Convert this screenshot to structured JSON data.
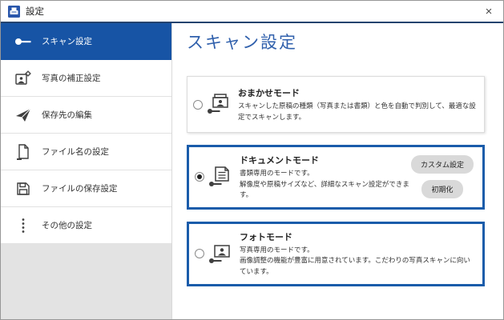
{
  "window": {
    "title": "設定",
    "close_glyph": "×"
  },
  "sidebar": {
    "items": [
      {
        "label": "スキャン設定",
        "icon": "scan-head-icon",
        "selected": true
      },
      {
        "label": "写真の補正設定",
        "icon": "photo-correction-icon",
        "selected": false
      },
      {
        "label": "保存先の編集",
        "icon": "send-icon",
        "selected": false
      },
      {
        "label": "ファイル名の設定",
        "icon": "file-name-icon",
        "selected": false
      },
      {
        "label": "ファイルの保存設定",
        "icon": "save-icon",
        "selected": false
      },
      {
        "label": "その他の設定",
        "icon": "more-dots-icon",
        "selected": false
      }
    ]
  },
  "main": {
    "heading": "スキャン設定",
    "modes": [
      {
        "title": "おまかせモード",
        "desc1": "スキャンした原稿の種類（写真または書類）と色を自動で判別して、最適な設定でスキャンします。",
        "desc2": "",
        "selected": false,
        "highlighted": false,
        "buttons": []
      },
      {
        "title": "ドキュメントモード",
        "desc1": "書類専用のモードです。",
        "desc2": "解像度や原稿サイズなど、詳細なスキャン設定ができます。",
        "selected": true,
        "highlighted": true,
        "buttons": [
          "カスタム設定",
          "初期化"
        ]
      },
      {
        "title": "フォトモード",
        "desc1": "写真専用のモードです。",
        "desc2": "画像調整の機能が豊富に用意されています。こだわりの写真スキャンに向いています。",
        "selected": false,
        "highlighted": true,
        "buttons": []
      }
    ]
  },
  "colors": {
    "sidebar_selected_blue": "#1754a5",
    "card_border_blue": "#1a5caa",
    "heading_blue": "#3060ac",
    "titlebar_accent_line": "#24436e",
    "pill_button_bg": "#d9d9d9",
    "sidebar_filler_gray": "#e3e3e3",
    "app_icon_blue": "#2a57ab"
  }
}
